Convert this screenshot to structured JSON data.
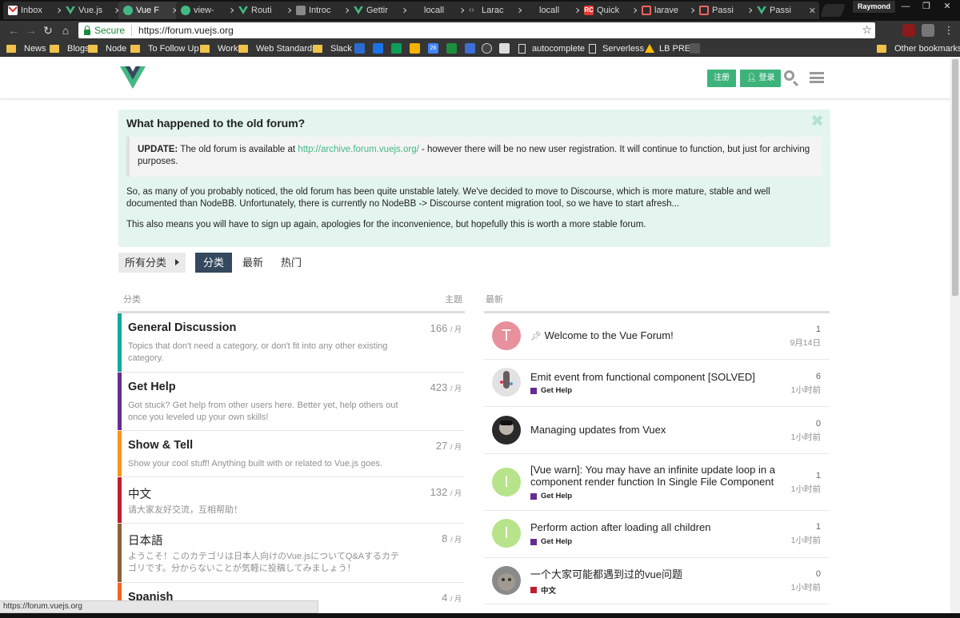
{
  "browser": {
    "tabs": [
      {
        "title": "Inbox",
        "icon": "gmail-icon",
        "color": "#d93025"
      },
      {
        "title": "Vue.js",
        "icon": "vue-icon",
        "color": "#42b983"
      },
      {
        "title": "Vue F",
        "icon": "vue-forum-icon",
        "color": "#42b983"
      },
      {
        "title": "view-",
        "icon": "vue-forum-icon",
        "color": "#42b983"
      },
      {
        "title": "Routi",
        "icon": "vue-icon",
        "color": "#42b983"
      },
      {
        "title": "Introc",
        "icon": "book-icon",
        "color": "#888888"
      },
      {
        "title": "Gettir",
        "icon": "vue-icon",
        "color": "#42b983"
      },
      {
        "title": "locall",
        "icon": "page-icon",
        "color": "#555555"
      },
      {
        "title": "Larac",
        "icon": "laracasts-icon",
        "color": "#888888"
      },
      {
        "title": "locall",
        "icon": "page-icon",
        "color": "#555555"
      },
      {
        "title": "Quick",
        "icon": "rc-icon",
        "color": "#e53935"
      },
      {
        "title": "larave",
        "icon": "laravel-icon",
        "color": "#f4645f"
      },
      {
        "title": "Passi",
        "icon": "laravel-icon",
        "color": "#f4645f"
      },
      {
        "title": "Passi",
        "icon": "vue-icon",
        "color": "#42b983"
      }
    ],
    "profile": "Raymond",
    "secure_label": "Secure",
    "url": "https://forum.vuejs.org",
    "bookmarks": [
      "News",
      "Blogs",
      "Node",
      "To Follow Up",
      "Work",
      "Web Standards",
      "Slack",
      "autocomplete",
      "Serverless",
      "LB PRE"
    ],
    "other_bookmarks": "Other bookmarks",
    "status_url": "https://forum.vuejs.org"
  },
  "header": {
    "signup": "注册",
    "login": "登录",
    "brand_color": "#42b983"
  },
  "banner": {
    "title": "What happened to the old forum?",
    "update_label": "UPDATE:",
    "update_text_1": "The old forum is available at",
    "update_link": "http://archive.forum.vuejs.org/",
    "update_text_2": "- however there will be no new user registration. It will continue to function, but just for archiving purposes.",
    "para1": "So, as many of you probably noticed, the old forum has been quite unstable lately. We've decided to move to Discourse, which is more mature, stable and well documented than NodeBB. Unfortunately, there is currently no NodeBB -> Discourse content migration tool, so we have to start afresh...",
    "para2": "This also means you will have to sign up again, apologies for the inconvenience, but hopefully this is worth a more stable forum."
  },
  "nav": {
    "all_categories": "所有分类",
    "tabs": [
      "分类",
      "最新",
      "热门"
    ]
  },
  "categories": {
    "col_category": "分类",
    "col_topics": "主题",
    "per": "/ 月",
    "rows": [
      {
        "name": "General Discussion",
        "desc": "Topics that don't need a category, or don't fit into any other existing category.",
        "count": "166",
        "color": "#12a89d"
      },
      {
        "name": "Get Help",
        "desc": "Got stuck? Get help from other users here. Better yet, help others out once you leveled up your own skills!",
        "count": "423",
        "color": "#652d90"
      },
      {
        "name": "Show & Tell",
        "desc": "Show your cool stuff! Anything built with or related to Vue.js goes.",
        "count": "27",
        "color": "#f7941d"
      },
      {
        "name": "中文",
        "desc": "请大家友好交流，互相帮助！",
        "count": "132",
        "color": "#bf1e2e"
      },
      {
        "name": "日本語",
        "desc": "ようこそ！このカテゴリは日本人向けのVue.jsについてQ&Aするカテゴリです。分からないことが気軽に投稿してみましょう！",
        "count": "8",
        "color": "#8c6238"
      },
      {
        "name": "Spanish",
        "desc": "",
        "count": "4",
        "color": "#f26522"
      }
    ]
  },
  "latest": {
    "col_latest": "最新",
    "topics": [
      {
        "title": "Welcome to the Vue Forum!",
        "pinned": true,
        "category": "",
        "cat_color": "",
        "replies": "1",
        "time": "9月14日",
        "avatar_letter": "T",
        "avatar_color": "#e8909c"
      },
      {
        "title": "Emit event from functional component [SOLVED]",
        "pinned": false,
        "category": "Get Help",
        "cat_color": "#652d90",
        "replies": "6",
        "time": "1小时前",
        "avatar_letter": "",
        "avatar_color": "#d9d9d9"
      },
      {
        "title": "Managing updates from Vuex",
        "pinned": false,
        "category": "",
        "cat_color": "",
        "replies": "0",
        "time": "1小时前",
        "avatar_letter": "",
        "avatar_color": "#333333"
      },
      {
        "title": "[Vue warn]: You may have an infinite update loop in a component render function In Single File Component",
        "pinned": false,
        "category": "Get Help",
        "cat_color": "#652d90",
        "replies": "1",
        "time": "1小时前",
        "avatar_letter": "I",
        "avatar_color": "#b7e38a"
      },
      {
        "title": "Perform action after loading all children",
        "pinned": false,
        "category": "Get Help",
        "cat_color": "#652d90",
        "replies": "1",
        "time": "1小时前",
        "avatar_letter": "I",
        "avatar_color": "#b7e38a"
      },
      {
        "title": "一个大家可能都遇到过的vue问题",
        "pinned": false,
        "category": "中文",
        "cat_color": "#bf1e2e",
        "replies": "0",
        "time": "1小时前",
        "avatar_letter": "",
        "avatar_color": "#8a8a8a"
      }
    ]
  }
}
